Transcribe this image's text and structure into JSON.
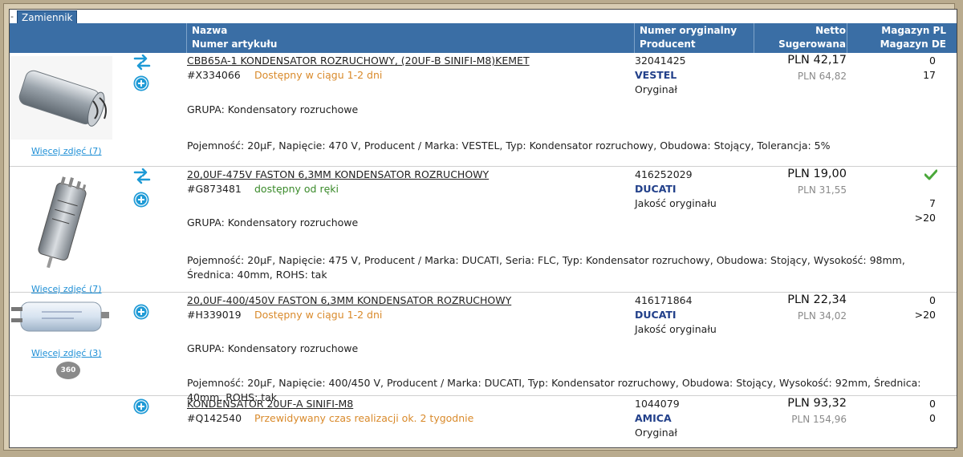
{
  "tab": {
    "dash": "-",
    "label": "Zamiennik"
  },
  "header": {
    "name": "Nazwa",
    "article": "Numer artykułu",
    "orig_number": "Numer oryginalny",
    "producer": "Producent",
    "netto": "Netto",
    "suggested": "Sugerowana",
    "stock_pl": "Magazyn PL",
    "stock_de": "Magazyn DE"
  },
  "rows": [
    {
      "name": "CBB65A-1 KONDENSATOR ROZRUCHOWY, (20UF-B SINIFI-M8)KEMET",
      "article": "#X334066",
      "availability": "Dostępny w ciągu 1-2 dni",
      "availability_color": "#d98a2b",
      "group": "GRUPA: Kondensatory rozruchowe",
      "specs": "Pojemność: 20µF, Napięcie: 470 V, Producent / Marka: VESTEL, Typ: Kondensator rozruchowy, Obudowa: Stojący, Tolerancja: 5%",
      "orig_number": "32041425",
      "producer": "VESTEL",
      "quality": "Oryginał",
      "price": "PLN 42,17",
      "suggested": "PLN 64,82",
      "stock_pl": "0",
      "stock_de": "17",
      "more_photos": "Więcej zdjęć (7)"
    },
    {
      "name": "20,0UF-475V FASTON 6,3MM KONDENSATOR ROZRUCHOWY",
      "article": "#G873481",
      "availability": "dostępny od ręki",
      "availability_color": "#3a8a2a",
      "group": "GRUPA: Kondensatory rozruchowe",
      "specs": "Pojemność: 20µF, Napięcie: 475 V, Producent / Marka: DUCATI, Seria: FLC, Typ: Kondensator rozruchowy, Obudowa: Stojący, Wysokość: 98mm, Średnica: 40mm, ROHS: tak",
      "orig_number": "416252029",
      "producer": "DUCATI",
      "quality": "Jakość oryginału",
      "price": "PLN 19,00",
      "suggested": "PLN 31,55",
      "stock_pl": "7",
      "stock_de": ">20",
      "more_photos": "Więcej zdjęć (7)"
    },
    {
      "name": "20,0UF-400/450V FASTON 6,3MM KONDENSATOR ROZRUCHOWY",
      "article": "#H339019",
      "availability": "Dostępny w ciągu 1-2 dni",
      "availability_color": "#d98a2b",
      "group": "GRUPA: Kondensatory rozruchowe",
      "specs": "Pojemność: 20µF, Napięcie: 400/450 V, Producent / Marka: DUCATI, Typ: Kondensator rozruchowy, Obudowa: Stojący, Wysokość: 92mm, Średnica: 40mm, ROHS: tak",
      "orig_number": "416171864",
      "producer": "DUCATI",
      "quality": "Jakość oryginału",
      "price": "PLN 22,34",
      "suggested": "PLN 34,02",
      "stock_pl": "0",
      "stock_de": ">20",
      "more_photos": "Więcej zdjęć (3)",
      "badge_360": "360"
    },
    {
      "name": "KONDENSATOR 20UF-A SINIFI-M8",
      "article": "#Q142540",
      "availability": "Przewidywany czas realizacji ok. 2 tygodnie",
      "availability_color": "#d98a2b",
      "orig_number": "1044079",
      "producer": "AMICA",
      "quality": "Oryginał",
      "price": "PLN 93,32",
      "suggested": "PLN 154,96",
      "stock_pl": "0",
      "stock_de": "0"
    }
  ],
  "colors": {
    "header_bg": "#3a6ea5",
    "producer": "#22408a",
    "link": "#1e8fd6",
    "in_stock_check": "#4aa83a"
  }
}
